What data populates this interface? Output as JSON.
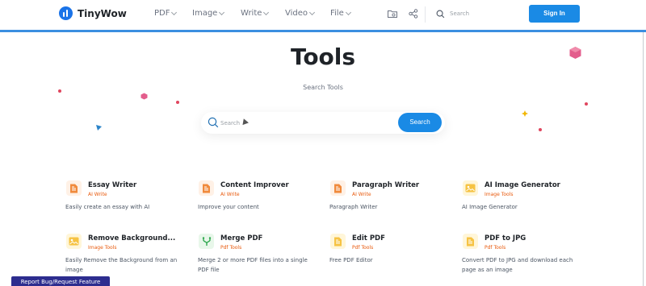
{
  "brand": {
    "name": "TinyWow"
  },
  "nav": [
    {
      "label": "PDF"
    },
    {
      "label": "Image"
    },
    {
      "label": "Write"
    },
    {
      "label": "Video"
    },
    {
      "label": "File"
    }
  ],
  "header": {
    "search_placeholder": "Search",
    "signin_label": "Sign In"
  },
  "hero": {
    "title": "Tools",
    "subtitle": "Search Tools",
    "search_placeholder": "Search",
    "search_button": "Search"
  },
  "colors": {
    "accent": "#1a8ae5",
    "write_category": "#e8590c",
    "image_category": "#f59f00",
    "pdf_category": "#e8590c"
  },
  "tools": [
    {
      "name": "Essay Writer",
      "category": "AI Write",
      "description": "Easily create an essay with AI",
      "icon": "document-pencil-icon"
    },
    {
      "name": "Content Improver",
      "category": "AI Write",
      "description": "Improve your content",
      "icon": "document-pencil-icon"
    },
    {
      "name": "Paragraph Writer",
      "category": "AI Write",
      "description": "Paragraph Writer",
      "icon": "document-pencil-icon"
    },
    {
      "name": "AI Image Generator",
      "category": "Image Tools",
      "description": "AI Image Generator",
      "icon": "image-icon"
    },
    {
      "name": "Remove Background...",
      "category": "Image Tools",
      "description": "Easily Remove the Background from an image",
      "icon": "image-icon"
    },
    {
      "name": "Merge PDF",
      "category": "Pdf Tools",
      "description": "Merge 2 or more PDF files into a single PDF file",
      "icon": "merge-icon"
    },
    {
      "name": "Edit PDF",
      "category": "Pdf Tools",
      "description": "Free PDF Editor",
      "icon": "pdf-icon"
    },
    {
      "name": "PDF to JPG",
      "category": "Pdf Tools",
      "description": "Convert PDF to JPG and download each page as an image",
      "icon": "pdf-icon"
    }
  ],
  "footer": {
    "report_label": "Report Bug/Request Feature"
  }
}
